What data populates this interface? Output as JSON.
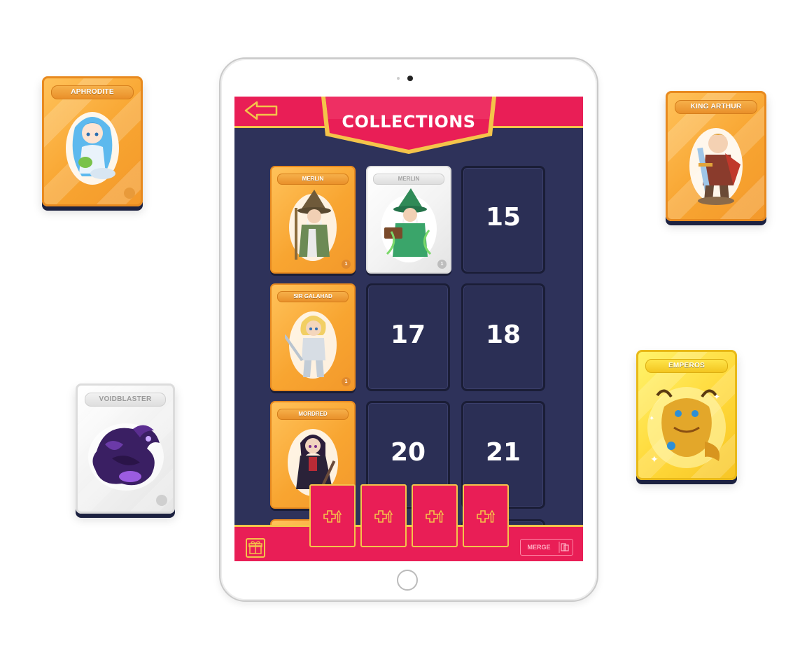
{
  "header": {
    "title": "COLLECTIONS"
  },
  "floating_cards": {
    "aphrodite": {
      "name": "APHRODITE",
      "rarity": "common"
    },
    "king_arthur": {
      "name": "KING ARTHUR",
      "rarity": "common"
    },
    "voidblaster": {
      "name": "VOIDBLASTER",
      "rarity": "white"
    },
    "emperos": {
      "name": "EMPEROS",
      "rarity": "gold"
    }
  },
  "grid": {
    "cards": [
      {
        "name": "MERLIN",
        "count": "1",
        "style": "orange"
      },
      {
        "name": "MERLIN",
        "count": "1",
        "style": "white"
      },
      {
        "name": "SIR GALAHAD",
        "count": "1",
        "style": "orange"
      },
      {
        "name": "MORDRED",
        "count": "",
        "style": "orange"
      }
    ],
    "empty_slots": [
      "15",
      "17",
      "18",
      "20",
      "21"
    ]
  },
  "footer": {
    "merge_label": "MERGE"
  },
  "colors": {
    "accent": "#e91e56",
    "border": "#f4c44a",
    "background": "#2e325a",
    "card_orange": "#f8a531"
  },
  "icons": [
    "back-arrow-icon",
    "gift-icon",
    "merge-icon",
    "add-upgrade-icon"
  ]
}
